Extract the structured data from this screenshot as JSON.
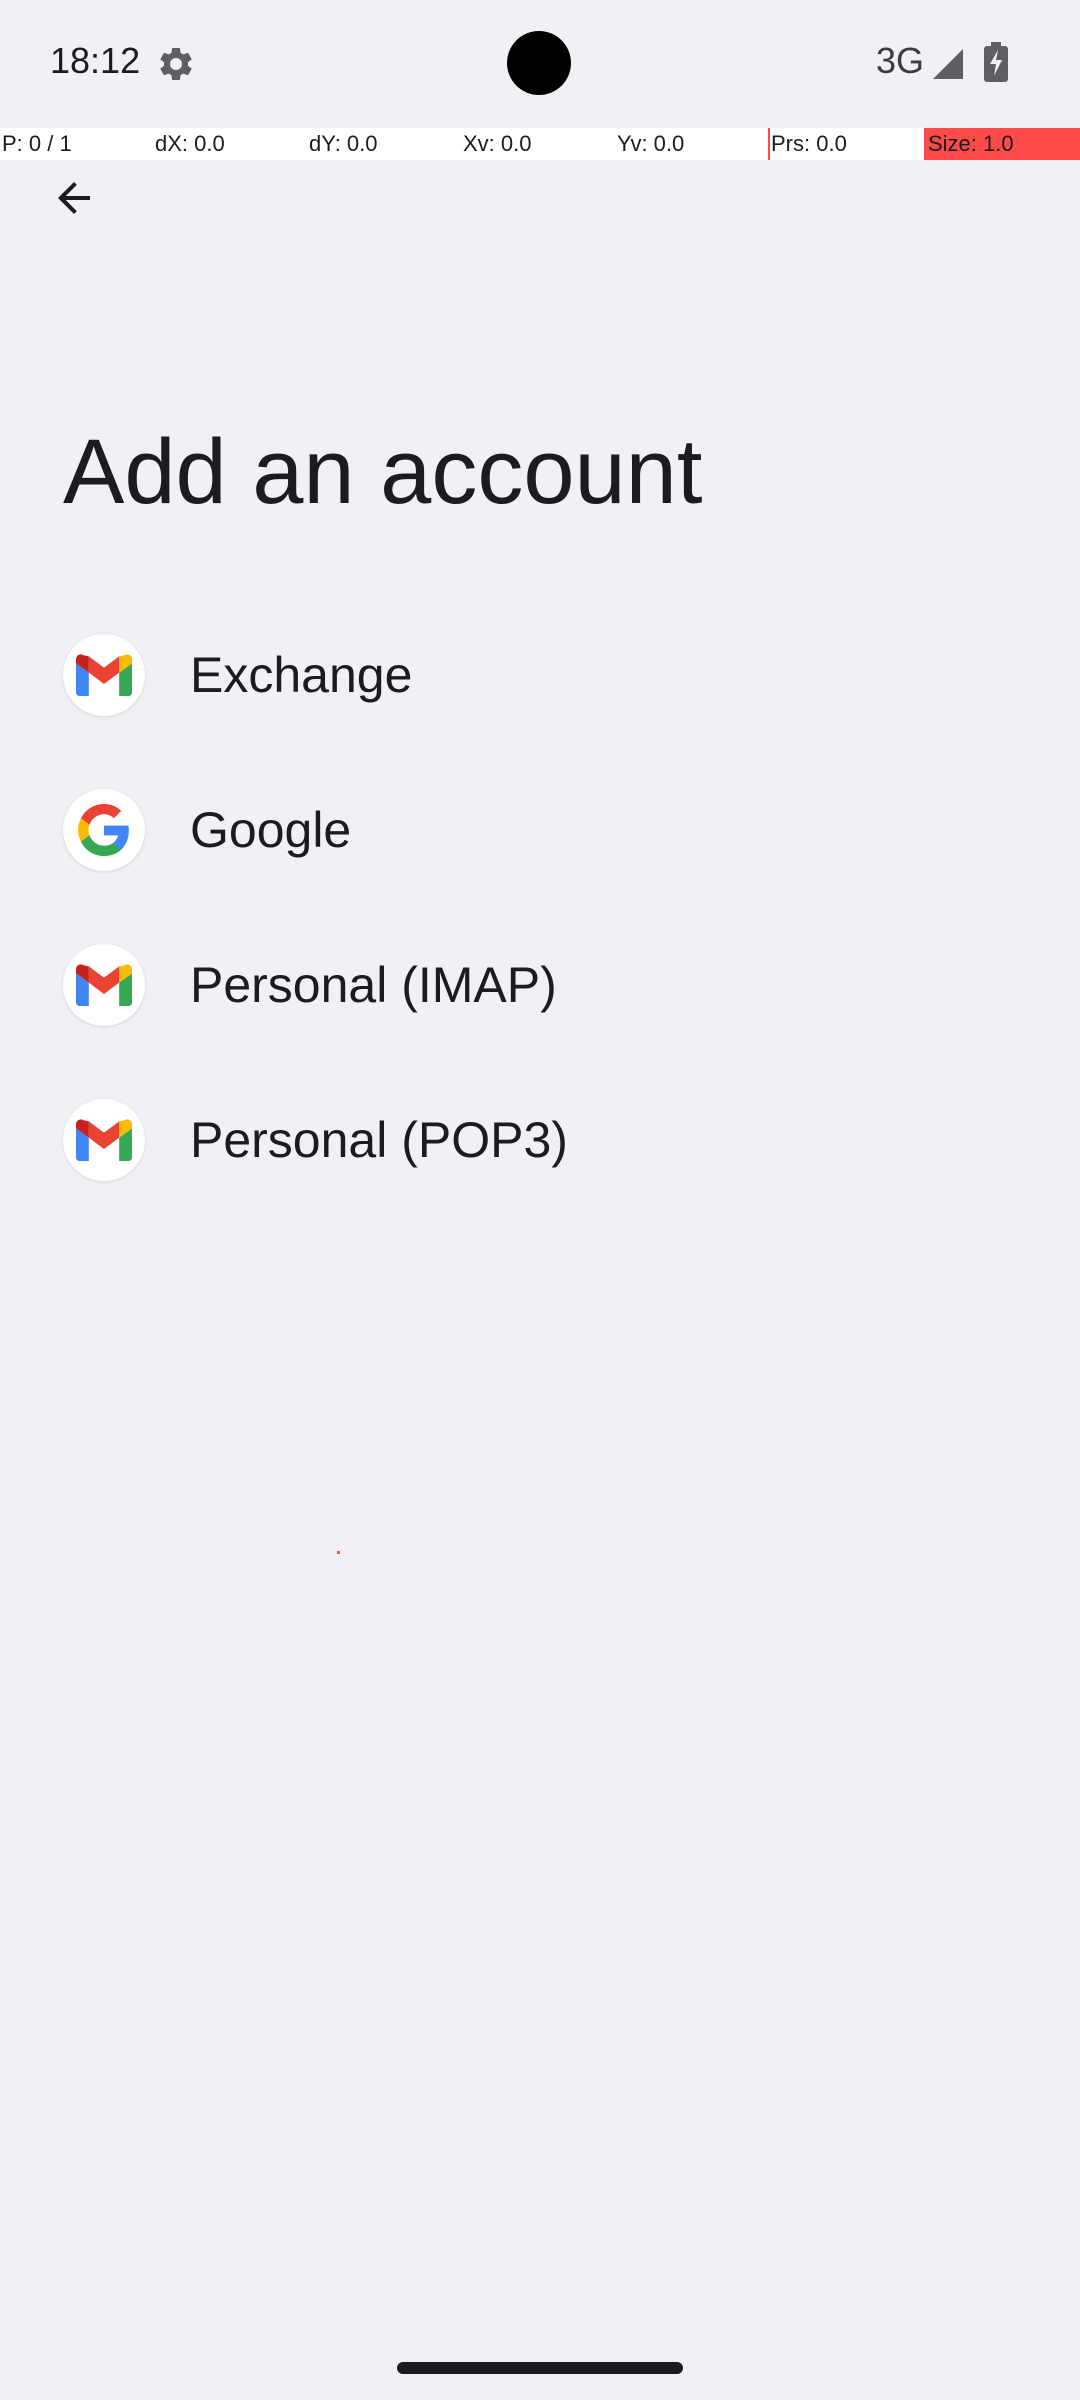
{
  "status_bar": {
    "time": "18:12",
    "network": "3G",
    "icons": [
      "settings-gear-icon",
      "signal-icon",
      "battery-charging-icon"
    ]
  },
  "debug_overlay": {
    "pointer": "P: 0 / 1",
    "dx": "dX: 0.0",
    "dy": "dY: 0.0",
    "xv": "Xv: 0.0",
    "yv": "Yv: 0.0",
    "prs": "Prs: 0.0",
    "size": "Size: 1.0"
  },
  "nav": {
    "back_icon": "arrow-back-icon"
  },
  "page": {
    "title": "Add an account"
  },
  "accounts": [
    {
      "label": "Exchange",
      "icon": "gmail-icon"
    },
    {
      "label": "Google",
      "icon": "google-icon"
    },
    {
      "label": "Personal (IMAP)",
      "icon": "gmail-icon"
    },
    {
      "label": "Personal (POP3)",
      "icon": "gmail-icon"
    }
  ],
  "colors": {
    "background": "#f2f0f5",
    "text": "#1c1b1f",
    "gmail_red": "#ea4335",
    "google_blue": "#4285f4",
    "google_green": "#34a853",
    "google_yellow": "#fbbc05",
    "debug_red": "#ff4a4a"
  }
}
